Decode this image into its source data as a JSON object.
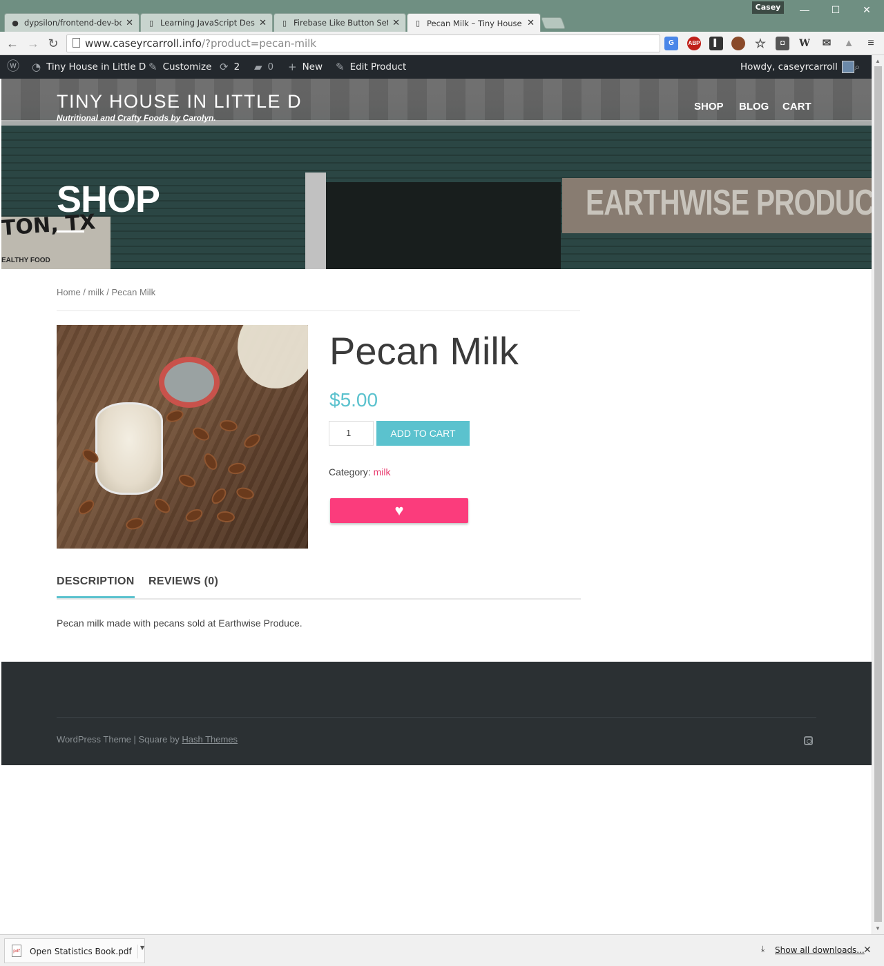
{
  "browser": {
    "tabs": [
      {
        "label": "dypsilon/frontend-dev-bo",
        "icon": "github-icon"
      },
      {
        "label": "Learning JavaScript Desig",
        "icon": "page-icon"
      },
      {
        "label": "Firebase Like Button Setti",
        "icon": "page-icon"
      },
      {
        "label": "Pecan Milk – Tiny House i",
        "icon": "page-icon",
        "active": true
      }
    ],
    "tab_close": "✕",
    "profile_name": "Casey",
    "url_host": "www.caseyrcarroll.info",
    "url_path": "/?product=pecan-milk",
    "extensions": [
      "google-translate-icon",
      "adblock-plus-icon",
      "reader-icon",
      "avatar-extension-icon",
      "bookmark-star-icon",
      "lightbulb-icon",
      "wikipedia-icon",
      "mail-check-icon",
      "drive-icon",
      "menu-icon"
    ],
    "ext_labels": {
      "abp": "ABP",
      "wiki": "W"
    }
  },
  "adminbar": {
    "site_name": "Tiny House in Little D",
    "customize": "Customize",
    "updates_count": "2",
    "comments_count": "0",
    "new_label": "New",
    "edit_label": "Edit Product",
    "howdy": "Howdy, caseyrcarroll"
  },
  "header": {
    "site_title": "TINY HOUSE IN LITTLE D",
    "tagline": "Nutritional and Crafty Foods by Carolyn.",
    "nav": [
      "SHOP",
      "BLOG",
      "CART"
    ],
    "page_title": "SHOP",
    "photo_sign_left": "TON, TX",
    "photo_sign_left_sub": "EALTHY FOOD",
    "photo_banner": "EARTHWISE PRODUCE"
  },
  "breadcrumb": {
    "home": "Home",
    "sep": " / ",
    "category": "milk",
    "current": "Pecan Milk"
  },
  "product": {
    "title": "Pecan Milk",
    "price": "$5.00",
    "quantity": "1",
    "add_to_cart": "ADD TO CART",
    "category_label": "Category: ",
    "category_value": "milk",
    "like_icon": "♥"
  },
  "tabs": {
    "description": "DESCRIPTION",
    "reviews": "REVIEWS (0)"
  },
  "description": "Pecan milk made with pecans sold at Earthwise Produce.",
  "footer": {
    "credit_prefix": "WordPress Theme | Square by ",
    "credit_link": "Hash Themes"
  },
  "downloads": {
    "file_name": "Open Statistics Book.pdf",
    "file_icon_text": "pdf",
    "show_all": "Show all downloads..."
  },
  "colors": {
    "accent": "#5bc2ce",
    "like": "#fb3c7c",
    "category_link": "#e8396d",
    "footer_bg": "#2b3033",
    "adminbar_bg": "#23282d"
  }
}
